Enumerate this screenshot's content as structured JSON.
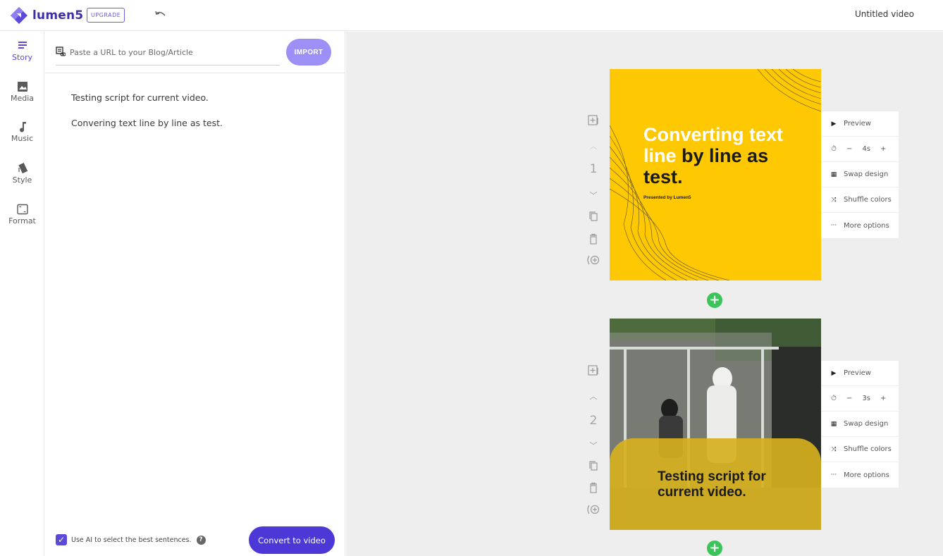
{
  "app": {
    "logo_text": "lumen5",
    "upgrade_label": "UPGRADE",
    "video_title": "Untitled video"
  },
  "rail": {
    "items": [
      {
        "label": "Story",
        "icon": "story-icon"
      },
      {
        "label": "Media",
        "icon": "image-icon"
      },
      {
        "label": "Music",
        "icon": "music-note-icon"
      },
      {
        "label": "Style",
        "icon": "palette-icon"
      },
      {
        "label": "Format",
        "icon": "format-icon"
      }
    ]
  },
  "story": {
    "url_placeholder": "Paste a URL to your Blog/Article",
    "import_label": "IMPORT",
    "script_lines": [
      "Testing script for current video.",
      "Convering text line by line as test."
    ],
    "ai_label": "Use AI to select the best sentences.",
    "ai_checked": true,
    "convert_label": "Convert to video"
  },
  "scenes": [
    {
      "number": "1",
      "title_white": "Converting text line",
      "title_dark": "by line as test.",
      "subtitle": "Presented by Lumen5",
      "duration": "4s"
    },
    {
      "number": "2",
      "caption": "Testing script for current video.",
      "duration": "3s"
    }
  ],
  "scene_menu": {
    "preview": "Preview",
    "minus": "−",
    "plus": "+",
    "swap": "Swap design",
    "shuffle": "Shuffle colors",
    "more": "More options"
  },
  "colors": {
    "accent": "#4b38d6",
    "slide_yellow": "#fec902",
    "add_green": "#3ac55a"
  }
}
